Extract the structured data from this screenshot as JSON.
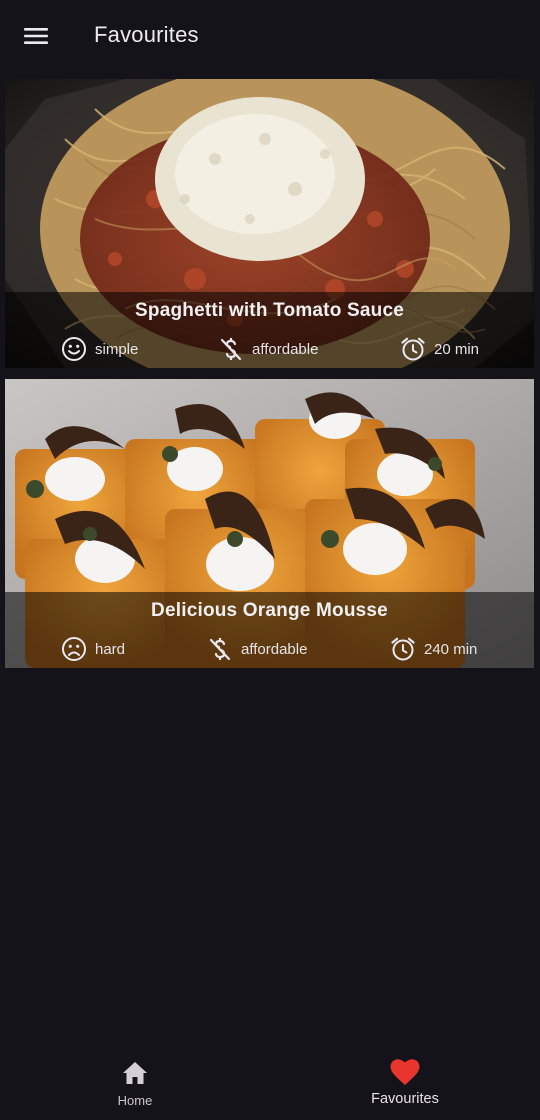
{
  "app_bar": {
    "title": "Favourites",
    "menu_icon": "hamburger-menu-icon"
  },
  "meals": [
    {
      "title": "Spaghetti with Tomato Sauce",
      "complexity": "simple",
      "complexity_icon": "smile-face-icon",
      "affordability": "affordable",
      "affordability_icon": "money-off-icon",
      "duration": "20 min",
      "duration_icon": "alarm-clock-icon",
      "image": "spaghetti with tomato sauce and grated cheese"
    },
    {
      "title": "Delicious Orange Mousse",
      "complexity": "hard",
      "complexity_icon": "sad-face-icon",
      "affordability": "affordable",
      "affordability_icon": "money-off-icon",
      "duration": "240 min",
      "duration_icon": "alarm-clock-icon",
      "image": "orange mousse cups topped with cream and chocolate curls"
    }
  ],
  "bottom_nav": {
    "items": [
      {
        "label": "Home",
        "icon": "home-icon",
        "selected": false
      },
      {
        "label": "Favourites",
        "icon": "heart-icon",
        "selected": true
      }
    ],
    "accent_color": "#e8352e"
  },
  "colors": {
    "background": "#15131a",
    "text": "#eceaf0"
  }
}
